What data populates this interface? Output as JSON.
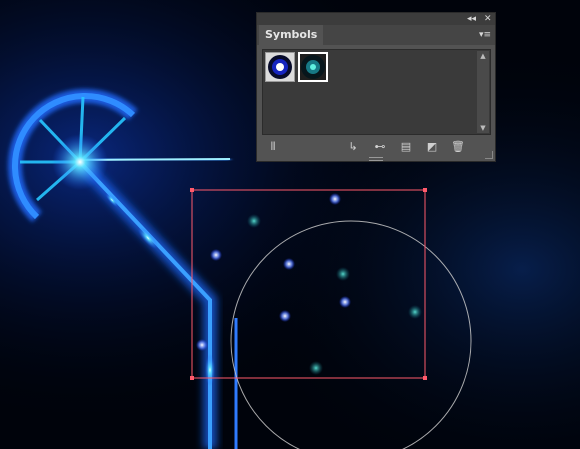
{
  "panel": {
    "collapse_icon_glyph": "◂◂",
    "close_icon_glyph": "✕",
    "tab_label": "Symbols",
    "menu_icon_glyph": "▾≡",
    "symbols": [
      {
        "name": "glow-sphere-blue",
        "selected": false
      },
      {
        "name": "glow-sphere-cyan",
        "selected": true
      }
    ],
    "scroll_up_glyph": "▲",
    "scroll_down_glyph": "▼",
    "toolbar": {
      "libraries_icon": "symbol-libraries-icon",
      "libraries_glyph": "⫴",
      "place_icon": "place-symbol-instance-icon",
      "place_glyph": "↳",
      "break_link_icon": "break-link-icon",
      "break_link_glyph": "⊷",
      "options_icon": "symbol-options-icon",
      "options_glyph": "▤",
      "new_icon": "new-symbol-icon",
      "new_glyph": "◩",
      "delete_icon": "delete-symbol-icon",
      "delete_glyph": "🗑"
    }
  },
  "colors": {
    "background": "#00030b",
    "glow_blue": "#1a5bff",
    "glow_cyan": "#27e0ff",
    "selection_box": "#ff5a6b",
    "circle_guide": "#c8c8c8",
    "panel_bg": "#535353"
  }
}
